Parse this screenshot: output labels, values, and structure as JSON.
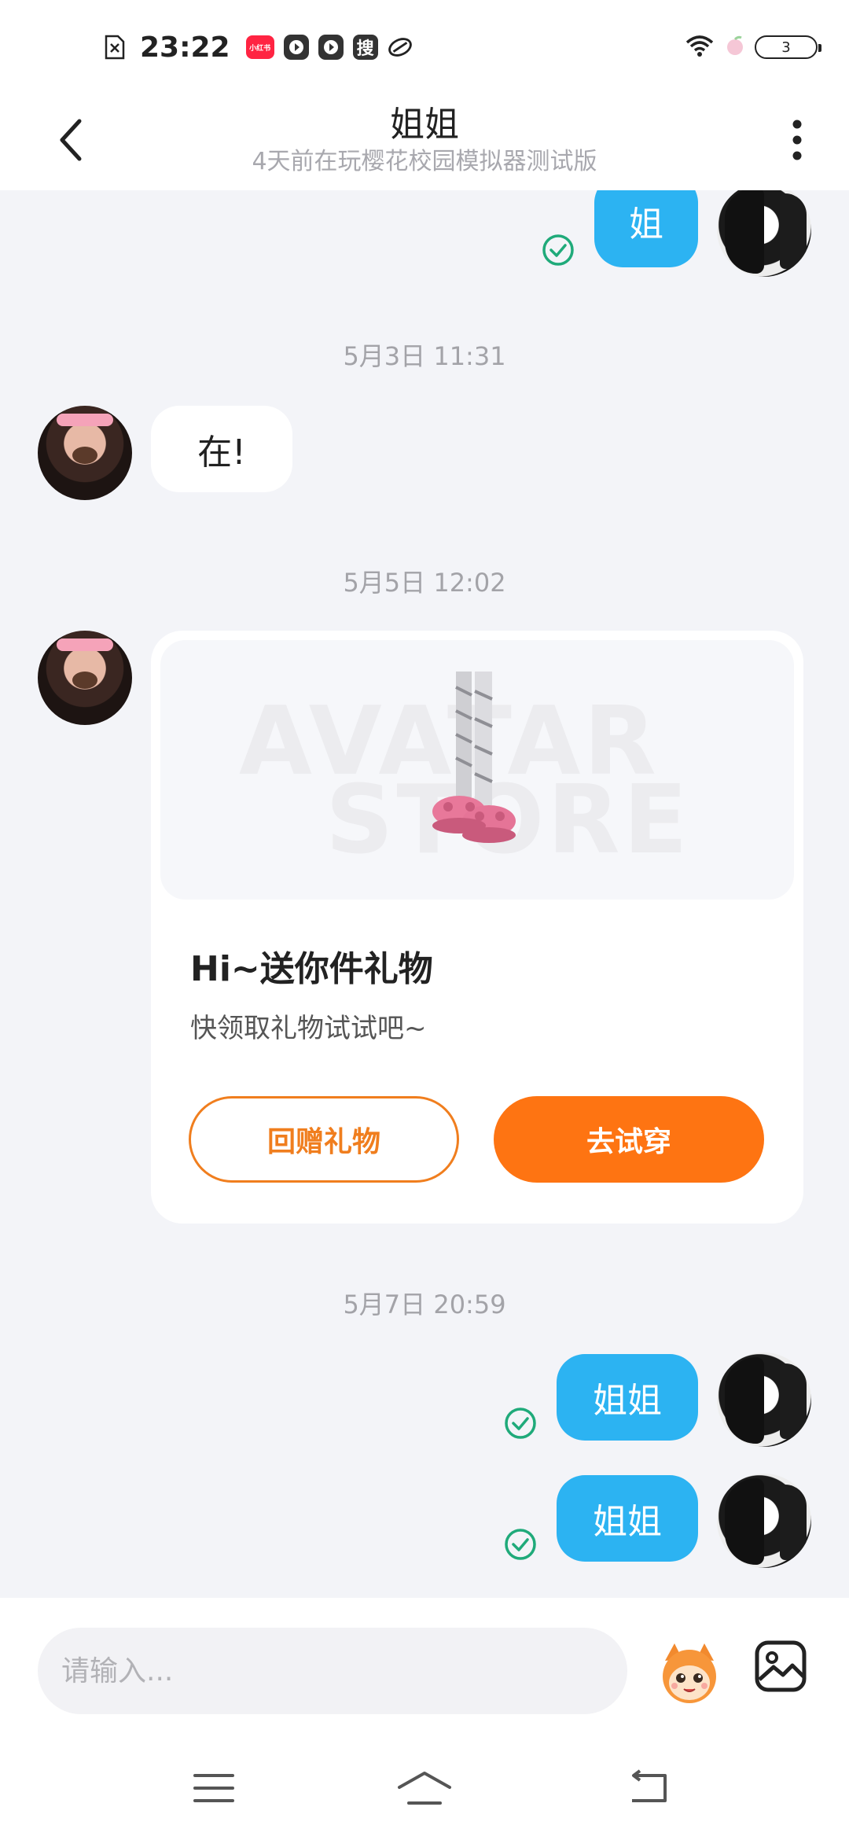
{
  "status_bar": {
    "time": "23:22",
    "xhs_label": "小红书",
    "sou_label": "搜",
    "battery": "3"
  },
  "header": {
    "title": "姐姐",
    "subtitle": "4天前在玩樱花校园模拟器测试版"
  },
  "messages": {
    "m1_text": "姐",
    "ts1": "5月3日 11:31",
    "m2_text": "在!",
    "ts2": "5月5日 12:02",
    "ts3": "5月7日 20:59",
    "m3_text": "姐姐",
    "m4_text": "姐姐"
  },
  "gift": {
    "watermark_1": "AVATAR",
    "watermark_2": "STORE",
    "title": "Hi~送你件礼物",
    "desc": "快领取礼物试试吧~",
    "return_label": "回赠礼物",
    "try_label": "去试穿"
  },
  "input": {
    "placeholder": "请输入..."
  },
  "colors": {
    "accent_blue": "#2cb3f2",
    "accent_orange": "#fe7412",
    "read_check": "#1faa7a"
  },
  "icons": [
    "back-icon",
    "more-icon",
    "read-check-icon",
    "mascot-icon",
    "image-icon",
    "menu-icon",
    "home-icon",
    "back-nav-icon"
  ]
}
